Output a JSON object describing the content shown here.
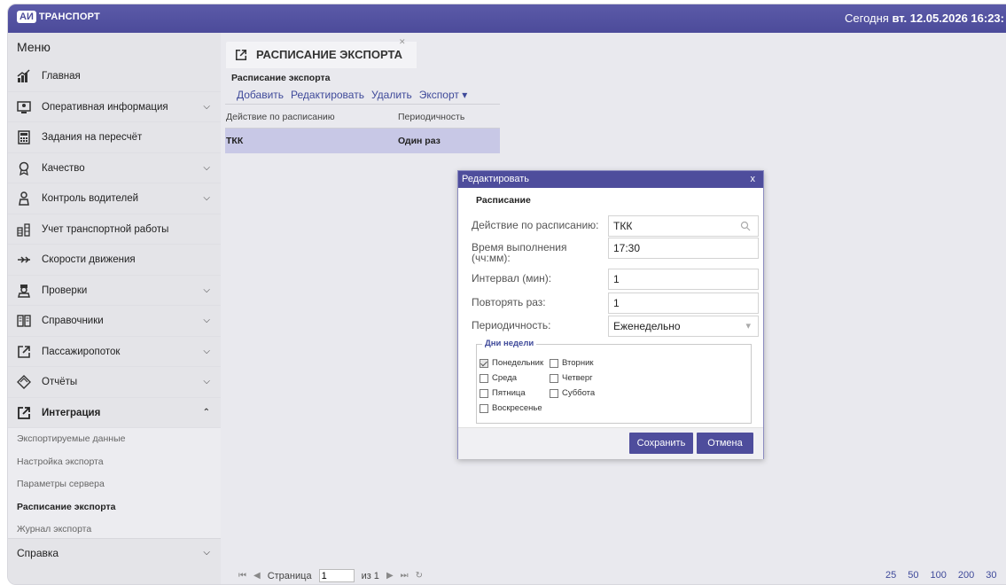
{
  "header": {
    "logo_badge": "АИ",
    "logo_text": "ТРАНСПОРТ",
    "today_label": "Сегодня",
    "today_value": "вт. 12.05.2026 16:23:"
  },
  "sidebar": {
    "menu_title": "Меню",
    "items": [
      {
        "label": "Главная"
      },
      {
        "label": "Оперативная информация"
      },
      {
        "label": "Задания на пересчёт"
      },
      {
        "label": "Качество"
      },
      {
        "label": "Контроль водителей"
      },
      {
        "label": "Учет транспортной работы"
      },
      {
        "label": "Скорости движения"
      },
      {
        "label": "Проверки"
      },
      {
        "label": "Справочники"
      },
      {
        "label": "Пассажиропоток"
      },
      {
        "label": "Отчёты"
      },
      {
        "label": "Интеграция"
      }
    ],
    "subitems": [
      "Экспортируемые данные",
      "Настройка экспорта",
      "Параметры сервера",
      "Расписание экспорта",
      "Журнал экспорта"
    ],
    "help_label": "Справка"
  },
  "main": {
    "tab_label": "РАСПИСАНИЕ ЭКСПОРТА",
    "section_title": "Расписание экспорта",
    "toolbar": {
      "add": "Добавить",
      "edit": "Редактировать",
      "delete": "Удалить",
      "export": "Экспорт ▾"
    },
    "grid": {
      "columns": [
        "Действие по расписанию",
        "Периодичность"
      ],
      "rows": [
        [
          "ТКК",
          "Один раз"
        ]
      ]
    },
    "pager": {
      "page_label": "Страница",
      "page_value": "1",
      "of_label": "из 1"
    },
    "page_sizes": [
      "25",
      "50",
      "100",
      "200",
      "30"
    ]
  },
  "dialog": {
    "title": "Редактировать",
    "close": "x",
    "section": "Расписание",
    "fields": {
      "action_label": "Действие по расписанию:",
      "action_value": "ТКК",
      "time_label": "Время выполнения (чч:мм):",
      "time_value": "17:30",
      "interval_label": "Интервал (мин):",
      "interval_value": "1",
      "repeat_label": "Повторять раз:",
      "repeat_value": "1",
      "period_label": "Периодичность:",
      "period_value": "Еженедельно"
    },
    "weekdays_legend": "Дни недели",
    "weekdays": {
      "mon": "Понедельник",
      "tue": "Вторник",
      "wed": "Среда",
      "thu": "Четверг",
      "fri": "Пятница",
      "sat": "Суббота",
      "sun": "Воскресенье"
    },
    "save": "Сохранить",
    "cancel": "Отмена"
  },
  "colors": {
    "accent": "#4e4d9c",
    "selected_row": "#c8c8e6"
  }
}
